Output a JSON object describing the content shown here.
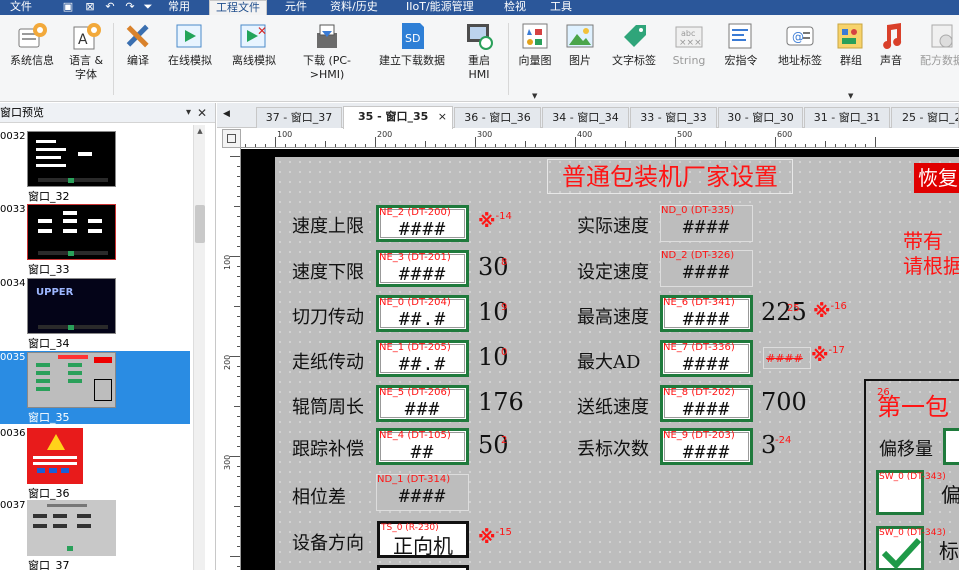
{
  "menu": {
    "file": "文件",
    "common": "常用",
    "project_file": "工程文件",
    "parts": "元件",
    "data_history": "资料/历史",
    "iiot": "IIoT/能源管理",
    "view": "检视",
    "tools": "工具"
  },
  "ribbon": {
    "system_info": "系统信息",
    "language_font": "语言 &\n字体",
    "compile": "编译",
    "online_sim": "在线模拟",
    "offline_sim": "离线模拟",
    "download": "下载 (PC-\n>HMI)",
    "build_download": "建立下载数据",
    "reboot_hmi": "重启\nHMI",
    "vector_graph": "向量图",
    "picture": "图片",
    "text_tag": "文字标签",
    "string": "String",
    "macro": "宏指令",
    "address_tag": "地址标签",
    "group": "群组",
    "sound": "声音",
    "recipe": "配方数据",
    "sd_label": "SD",
    "abc_label": "abc"
  },
  "left_panel": {
    "title": "窗口预览",
    "items": [
      {
        "num": "0032",
        "caption": "窗口_32"
      },
      {
        "num": "0033",
        "caption": "窗口_33"
      },
      {
        "num": "0034",
        "caption": "窗口_34"
      },
      {
        "num": "0035",
        "caption": "窗口_35"
      },
      {
        "num": "0036",
        "caption": "窗口_36"
      },
      {
        "num": "0037",
        "caption": "窗口_37"
      }
    ],
    "logo_text": "UPPER"
  },
  "tabs": [
    {
      "label": "37 - 窗口_37"
    },
    {
      "label": "35 - 窗口_35"
    },
    {
      "label": "36 - 窗口_36"
    },
    {
      "label": "34 - 窗口_34"
    },
    {
      "label": "33 - 窗口_33"
    },
    {
      "label": "30 - 窗口_30"
    },
    {
      "label": "31 - 窗口_31"
    },
    {
      "label": "25 - 窗口_25"
    }
  ],
  "tab_close": "×",
  "ruler": {
    "h": [
      "100",
      "200",
      "300",
      "400",
      "500",
      "600"
    ],
    "v": [
      "100",
      "200",
      "300"
    ]
  },
  "screen": {
    "title": "普通包装机厂家设置",
    "restore": "恢复",
    "note1": "带有",
    "note2": "请根据",
    "labels": {
      "speed_upper": "速度上限",
      "speed_lower": "速度下限",
      "cutter_drive": "切刀传动",
      "paper_drive": "走纸传动",
      "roller_perimeter": "辊筒周长",
      "tracking_comp": "跟踪补偿",
      "phase_diff": "相位差",
      "device_direction": "设备方向",
      "actual_speed": "实际速度",
      "set_speed": "设定速度",
      "max_speed": "最高速度",
      "max_ad": "最大AD",
      "feed_speed": "送纸速度",
      "lost_mark_count": "丢标次数",
      "first_pkg": "第一包",
      "offset": "偏移量",
      "sw1_label": "偏",
      "sw2_label": "标"
    },
    "boxes": {
      "ne2": {
        "tag": "NE_2 (DT-200)",
        "val": "####"
      },
      "ne3": {
        "tag": "NE_3 (DT-201)",
        "val": "####"
      },
      "ne0": {
        "tag": "NE_0 (DT-204)",
        "val": "##.#"
      },
      "ne1": {
        "tag": "NE_1 (DT-205)",
        "val": "##.#"
      },
      "ne5": {
        "tag": "NE_5 (DT-206)",
        "val": "###"
      },
      "ne4": {
        "tag": "NE_4 (DT-105)",
        "val": "##"
      },
      "nd1": {
        "tag": "ND_1 (DT-314)",
        "val": "####"
      },
      "nd0": {
        "tag": "ND_0 (DT-335)",
        "val": "####"
      },
      "nd2": {
        "tag": "ND_2 (DT-326)",
        "val": "####"
      },
      "ne6": {
        "tag": "NE_6 (DT-341)",
        "val": "####"
      },
      "ne7": {
        "tag": "NE_7 (DT-336)",
        "val": "####"
      },
      "ne8": {
        "tag": "NE_8 (DT-202)",
        "val": "####"
      },
      "ne9": {
        "tag": "NE_9 (DT-203)",
        "val": "####"
      }
    },
    "static_values": {
      "v30": "30",
      "v10a": "10",
      "v10b": "10",
      "v176": "176",
      "v50": "50",
      "v225": "225",
      "v700": "700",
      "v3": "3"
    },
    "marks": {
      "m14": "-14",
      "m15": "-15",
      "m16": "-16",
      "m17": "-17",
      "m24": "-24",
      "m8": "8",
      "m9": "9",
      "m0": "0",
      "m2": "2",
      "m25": "25",
      "m26": "26"
    },
    "star": "※",
    "direction_btn": {
      "tag": "TS_0 (R-230)",
      "val": "正向机"
    },
    "sw_tag": "SW_0 (DT-343)"
  }
}
